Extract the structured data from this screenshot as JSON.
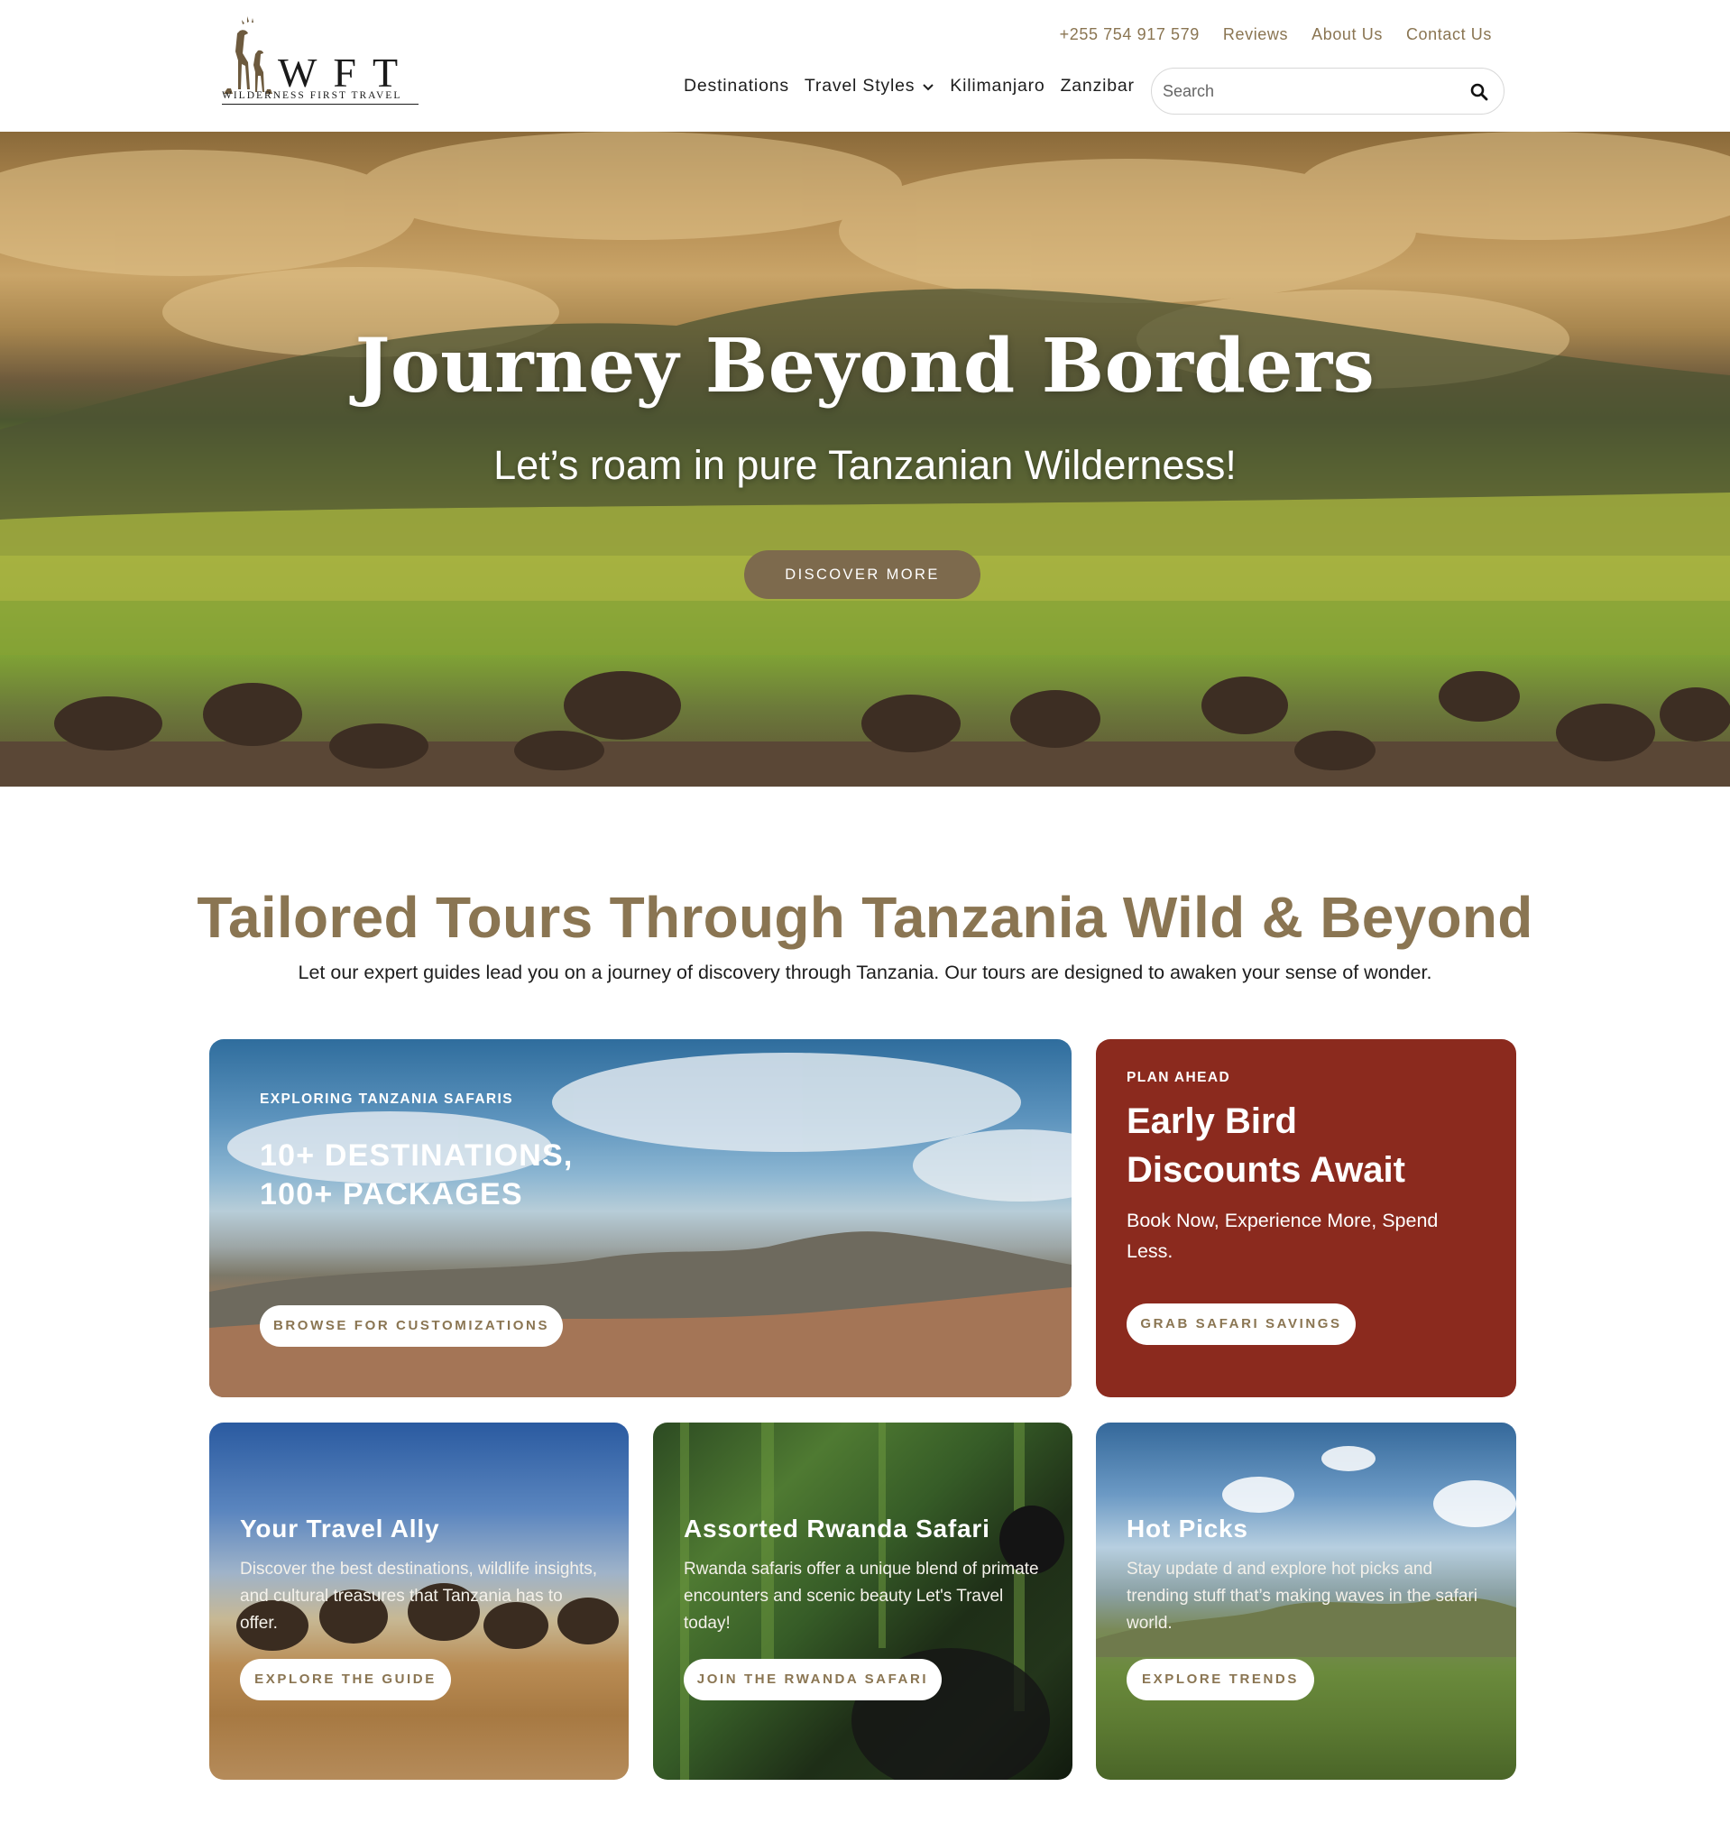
{
  "header": {
    "logo": {
      "letters": "WFT",
      "tagline": "WILDERNESS FIRST TRAVEL"
    },
    "topbar": {
      "phone": "+255 754 917 579",
      "reviews": "Reviews",
      "about": "About Us",
      "contact": "Contact Us"
    },
    "nav": {
      "destinations": "Destinations",
      "travel_styles": "Travel Styles",
      "kilimanjaro": "Kilimanjaro",
      "zanzibar": "Zanzibar"
    },
    "search": {
      "placeholder": "Search"
    }
  },
  "hero": {
    "title": "Journey Beyond Borders",
    "subtitle": "Let’s roam in pure Tanzanian Wilderness!",
    "button": "DISCOVER MORE"
  },
  "intro": {
    "title": "Tailored Tours Through Tanzania Wild & Beyond",
    "text": "Let our expert guides lead you on a journey of discovery through Tanzania. Our tours are designed to awaken your sense of wonder."
  },
  "cards": {
    "safaris": {
      "eyebrow": "EXPLORING TANZANIA SAFARIS",
      "line1": "10+ DESTINATIONS,",
      "line2": "100+ PACKAGES",
      "button": "BROWSE FOR CUSTOMIZATIONS"
    },
    "early_bird": {
      "eyebrow": "PLAN AHEAD",
      "line1": "Early Bird",
      "line2": "Discounts Await",
      "body": "Book Now, Experience More, Spend Less.",
      "button": "GRAB SAFARI SAVINGS"
    },
    "travel_ally": {
      "title": "Your Travel Ally",
      "body": "Discover the best destinations, wildlife insights, and cultural treasures that Tanzania has to offer.",
      "button": "EXPLORE THE GUIDE"
    },
    "rwanda": {
      "title": "Assorted Rwanda Safari",
      "body": "Rwanda safaris offer a unique blend of primate encounters and scenic beauty Let's Travel today!",
      "button": "JOIN THE RWANDA SAFARI"
    },
    "hot_picks": {
      "title": "Hot Picks",
      "body": "Stay update d and explore hot picks and trending stuff that’s making waves in the safari world.",
      "button": "EXPLORE TRENDS"
    }
  },
  "colors": {
    "brand_brown": "#8a7552",
    "hero_button": "#7d6a4d",
    "promo_red": "#8b2a1e"
  },
  "icons": {
    "search": "search-icon",
    "chevron": "chevron-down-icon",
    "logo": "giraffe-logo-icon"
  }
}
